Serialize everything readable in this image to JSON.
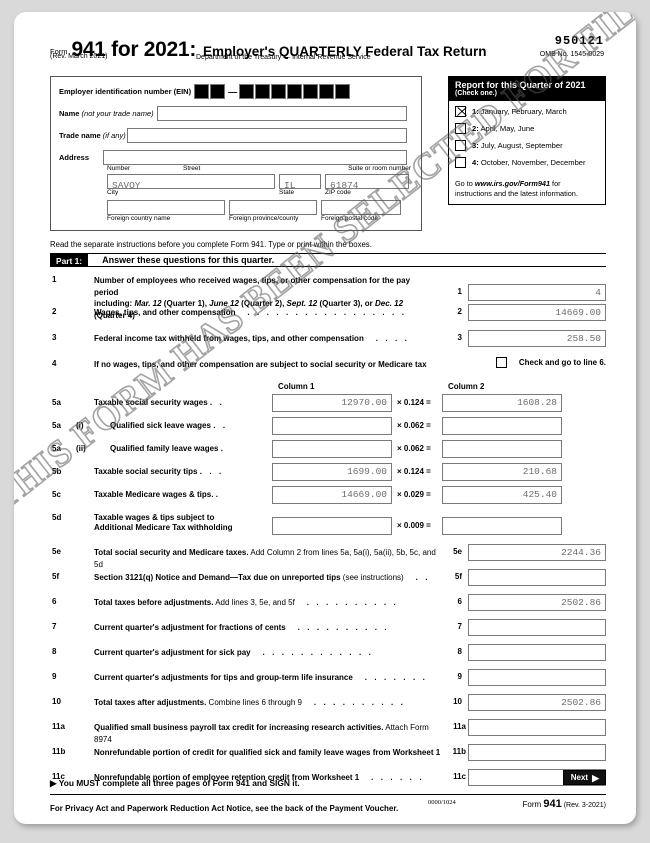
{
  "header": {
    "form_label": "Form",
    "form_number": "941 for 2021:",
    "title": "Employer's QUARTERLY Federal Tax Return",
    "revision": "(Rev. March 2021)",
    "department": "Department of the Treasury — Internal Revenue Service",
    "form_code": "950121",
    "omb": "OMB No. 1545-0029"
  },
  "employer": {
    "ein_label": "Employer identification number (EIN)",
    "ein_value": "",
    "name_label": "Name",
    "name_label_italic": "(not your trade name)",
    "name_value": "",
    "trade_label": "Trade name",
    "trade_label_italic": "(if any)",
    "trade_value": "",
    "address_label": "Address",
    "address_value": "",
    "sub_number": "Number",
    "sub_street": "Street",
    "sub_suite": "Suite or room number",
    "city_value": "SAVOY",
    "state_value": "IL",
    "zip_value": "61874",
    "sub_city": "City",
    "sub_state": "State",
    "sub_zip": "ZIP code",
    "foreign_country_value": "",
    "foreign_province_value": "",
    "foreign_postal_value": "",
    "sub_foreign_country": "Foreign country name",
    "sub_foreign_province": "Foreign province/county",
    "sub_foreign_postal": "Foreign postal code"
  },
  "quarter": {
    "heading": "Report for this Quarter of 2021",
    "subheading": "(Check one.)",
    "options": [
      {
        "num": "1:",
        "label": " January, February, March",
        "checked": true
      },
      {
        "num": "2:",
        "label": " April, May, June",
        "checked": false
      },
      {
        "num": "3:",
        "label": " July, August, September",
        "checked": false
      },
      {
        "num": "4:",
        "label": " October, November, December",
        "checked": false
      }
    ],
    "goto_pre": "Go to ",
    "goto_link": "www.irs.gov/Form941",
    "goto_post": " for instructions and the latest information."
  },
  "read_instruction": "Read the separate instructions before you complete Form 941. Type or print within the boxes.",
  "part1": {
    "tag": "Part 1:",
    "title": "Answer these questions for this quarter."
  },
  "lines": {
    "l1_num": "1",
    "l1_text_a": "Number of employees who received wages, tips, or other compensation for the pay period",
    "l1_text_b": "including: ",
    "l1_text_b1": "Mar. 12",
    "l1_text_b2": " (Quarter 1), ",
    "l1_text_b3": "June 12",
    "l1_text_b4": " (Quarter 2), ",
    "l1_text_b5": "Sept. 12",
    "l1_text_b6": " (Quarter 3), or ",
    "l1_text_b7": "Dec. 12",
    "l1_text_b8": " (Quarter 4)",
    "l1_ref": "1",
    "l1_value": "4",
    "l2_num": "2",
    "l2_text": "Wages, tips, and other compensation",
    "l2_ref": "2",
    "l2_value": "14669.00",
    "l3_num": "3",
    "l3_text": "Federal income tax withheld from wages, tips, and other compensation",
    "l3_ref": "3",
    "l3_value": "258.50",
    "l4_num": "4",
    "l4_text": "If no wages, tips, and other compensation are subject to social security or Medicare tax",
    "l4_checkbox_label": "Check and go to line 6.",
    "l4_checked": false,
    "col1_header": "Column 1",
    "col2_header": "Column 2",
    "l5a_num": "5a",
    "l5a_text": "Taxable social security wages",
    "l5a_dots": ".  .",
    "l5a_col1": "12970.00",
    "l5a_rate": "× 0.124 =",
    "l5a_col2": "1608.28",
    "l5ai_num": "5a",
    "l5ai_sub": "(i)",
    "l5ai_text": "Qualified sick leave wages",
    "l5ai_dots": ".  .",
    "l5ai_col1": "",
    "l5ai_rate": "× 0.062 =",
    "l5ai_col2": "",
    "l5aii_num": "5a",
    "l5aii_sub": "(ii)",
    "l5aii_text": "Qualified family leave wages",
    "l5aii_dots": ".",
    "l5aii_col1": "",
    "l5aii_rate": "× 0.062 =",
    "l5aii_col2": "",
    "l5b_num": "5b",
    "l5b_text": "Taxable social security tips",
    "l5b_dots": ".  .  .",
    "l5b_col1": "1699.00",
    "l5b_rate": "× 0.124 =",
    "l5b_col2": "210.68",
    "l5c_num": "5c",
    "l5c_text": "Taxable Medicare wages & tips.",
    "l5c_dots": ".",
    "l5c_col1": "14669.00",
    "l5c_rate": "× 0.029 =",
    "l5c_col2": "425.40",
    "l5d_num": "5d",
    "l5d_text_a": "Taxable wages & tips subject to",
    "l5d_text_b": "Additional Medicare Tax withholding",
    "l5d_col1": "",
    "l5d_rate": "× 0.009 =",
    "l5d_col2": "",
    "l5e_num": "5e",
    "l5e_text_bold": "Total social security and Medicare taxes.",
    "l5e_text_norm": " Add Column 2 from lines 5a, 5a(i), 5a(ii), 5b, 5c, and 5d",
    "l5e_ref": "5e",
    "l5e_value": "2244.36",
    "l5f_num": "5f",
    "l5f_text_bold": "Section 3121(q) Notice and Demand—Tax due on unreported tips",
    "l5f_text_norm": " (see instructions)",
    "l5f_ref": "5f",
    "l5f_value": "",
    "l6_num": "6",
    "l6_text_bold": "Total taxes before adjustments.",
    "l6_text_norm": " Add lines 3, 5e, and 5f",
    "l6_ref": "6",
    "l6_value": "2502.86",
    "l7_num": "7",
    "l7_text": "Current quarter's adjustment for fractions of cents",
    "l7_ref": "7",
    "l7_value": "",
    "l8_num": "8",
    "l8_text": "Current quarter's adjustment for sick pay",
    "l8_ref": "8",
    "l8_value": "",
    "l9_num": "9",
    "l9_text": "Current quarter's adjustments for tips and group-term life insurance",
    "l9_ref": "9",
    "l9_value": "",
    "l10_num": "10",
    "l10_text_bold": "Total taxes after adjustments.",
    "l10_text_norm": " Combine lines 6 through 9",
    "l10_ref": "10",
    "l10_value": "2502.86",
    "l11a_num": "11a",
    "l11a_text_bold": "Qualified small business payroll tax credit for increasing research activities.",
    "l11a_text_norm": " Attach Form 8974",
    "l11a_ref": "11a",
    "l11a_value": "",
    "l11b_num": "11b",
    "l11b_text": "Nonrefundable portion of credit for qualified sick and family leave wages from Worksheet 1",
    "l11b_ref": "11b",
    "l11b_value": "",
    "l11c_num": "11c",
    "l11c_text": "Nonrefundable portion of employee retention credit from Worksheet 1",
    "l11c_ref": "11c",
    "l11c_value": ""
  },
  "footer": {
    "must_arrow": "▶",
    "must_text": "You MUST complete all three pages of Form 941 and SIGN it.",
    "next_label": "Next",
    "next_arrow": "▶",
    "privacy": "For Privacy Act and Paperwork Reduction Act Notice, see the back of the Payment Voucher.",
    "cat_no": "0000/1024",
    "form_prefix": "Form ",
    "form_num": "941",
    "form_rev": " (Rev. 3-2021)"
  },
  "watermark": {
    "text": "THIS FORM HAS BEEN SELECTED FOR FILING"
  }
}
